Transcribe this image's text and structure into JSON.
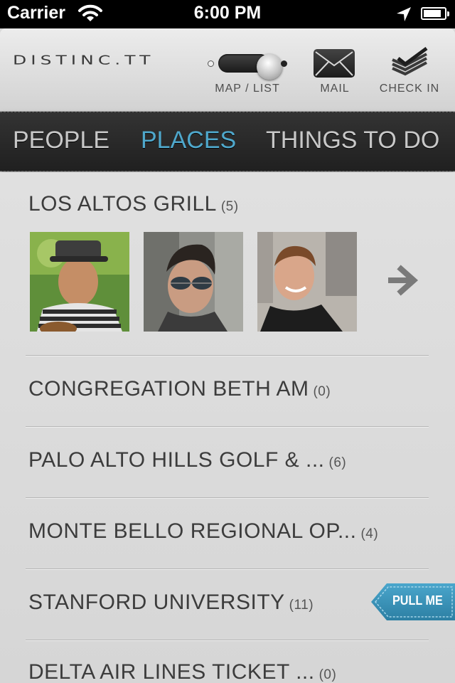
{
  "status_bar": {
    "carrier": "Carrier",
    "time": "6:00 PM",
    "icons": [
      "wifi-icon",
      "location-arrow-icon",
      "battery-icon"
    ],
    "battery_level": 0.85
  },
  "toolbar": {
    "logo": "DISTINC.TT",
    "map_list_label": "MAP / LIST",
    "mail_label": "MAIL",
    "checkin_label": "CHECK IN",
    "icons": [
      "mail-icon",
      "check-in-icon"
    ]
  },
  "categories": {
    "items": [
      {
        "label": "PEOPLE",
        "active": false
      },
      {
        "label": "PLACES",
        "active": true
      },
      {
        "label": "THINGS TO DO",
        "active": false
      }
    ]
  },
  "places": [
    {
      "name": "LOS ALTOS GRILL",
      "count": "(5)",
      "photos": [
        "person-photo-1",
        "person-photo-2",
        "person-photo-3"
      ]
    },
    {
      "name": "CONGREGATION BETH AM",
      "count": "(0)"
    },
    {
      "name": "PALO ALTO HILLS GOLF & ...",
      "count": "(6)"
    },
    {
      "name": "MONTE BELLO REGIONAL OP...",
      "count": "(4)"
    },
    {
      "name": "STANFORD UNIVERSITY",
      "count": "(11)"
    },
    {
      "name": "DELTA AIR LINES TICKET ...",
      "count": "(0)"
    }
  ],
  "pull_tab": {
    "label": "PULL ME"
  },
  "colors": {
    "accent": "#4fa8cc",
    "nav_background": "#2a2a2a",
    "list_background": "#dcdcdc",
    "pull_tab": "#3a8fb2"
  }
}
